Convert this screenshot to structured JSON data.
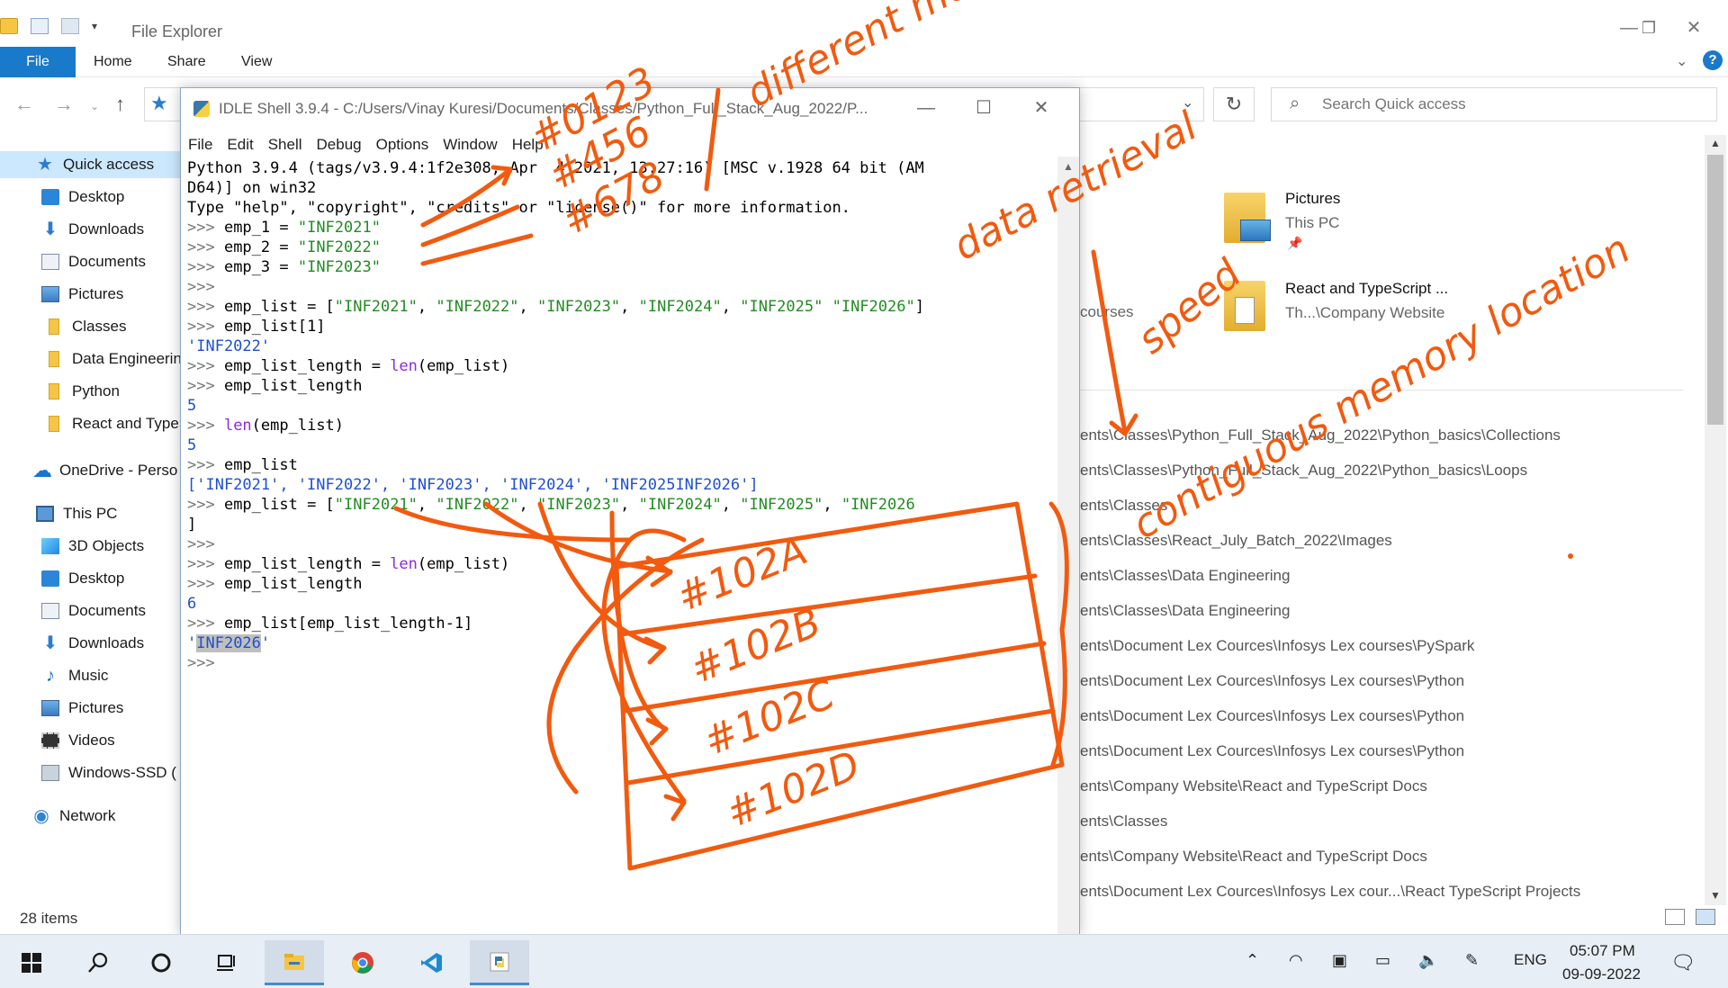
{
  "explorer": {
    "title": "File Explorer",
    "ribbon_tabs": [
      "File",
      "Home",
      "Share",
      "View"
    ],
    "search_placeholder": "Search Quick access",
    "nav_items": [
      {
        "label": "Quick access",
        "icon": "star-icon",
        "selected": true
      },
      {
        "label": "Desktop",
        "icon": "desktop-icon"
      },
      {
        "label": "Downloads",
        "icon": "download-icon"
      },
      {
        "label": "Documents",
        "icon": "documents-icon"
      },
      {
        "label": "Pictures",
        "icon": "pictures-icon"
      },
      {
        "label": "Classes",
        "icon": "folder-icon"
      },
      {
        "label": "Data Engineerin",
        "icon": "folder-icon"
      },
      {
        "label": "Python",
        "icon": "folder-icon"
      },
      {
        "label": "React and TypeS",
        "icon": "folder-icon"
      },
      {
        "label": "OneDrive - Perso",
        "icon": "cloud-icon"
      },
      {
        "label": "This PC",
        "icon": "pc-icon"
      },
      {
        "label": "3D Objects",
        "icon": "3d-objects-icon"
      },
      {
        "label": "Desktop",
        "icon": "desktop-icon"
      },
      {
        "label": "Documents",
        "icon": "documents-icon"
      },
      {
        "label": "Downloads",
        "icon": "download-icon"
      },
      {
        "label": "Music",
        "icon": "music-icon"
      },
      {
        "label": "Pictures",
        "icon": "pictures-icon"
      },
      {
        "label": "Videos",
        "icon": "videos-icon"
      },
      {
        "label": "Windows-SSD (",
        "icon": "drive-icon"
      },
      {
        "label": "Network",
        "icon": "network-icon"
      }
    ],
    "status": "28 items",
    "quick_tiles": [
      {
        "name": "Pictures",
        "sub": "This PC"
      },
      {
        "name": "React and TypeScript ...",
        "sub": "Th...\\Company Website"
      }
    ],
    "partial_text": "courses",
    "recent_paths": [
      "ents\\Classes\\Python_Full_Stack_Aug_2022\\Python_basics\\Collections",
      "ents\\Classes\\Python_Full_Stack_Aug_2022\\Python_basics\\Loops",
      "ents\\Classes",
      "ents\\Classes\\React_July_Batch_2022\\Images",
      "ents\\Classes\\Data Engineering",
      "ents\\Classes\\Data Engineering",
      "ents\\Document Lex Cources\\Infosys Lex courses\\PySpark",
      "ents\\Document Lex Cources\\Infosys Lex courses\\Python",
      "ents\\Document Lex Cources\\Infosys Lex courses\\Python",
      "ents\\Document Lex Cources\\Infosys Lex courses\\Python",
      "ents\\Company Website\\React and TypeScript Docs",
      "ents\\Classes",
      "ents\\Company Website\\React and TypeScript Docs",
      "ents\\Document Lex Cources\\Infosys Lex cour...\\React TypeScript Projects"
    ]
  },
  "idle": {
    "title": "IDLE Shell 3.9.4 - C:/Users/Vinay Kuresi/Documents/Classes/Python_Full_Stack_Aug_2022/P...",
    "menu": [
      "File",
      "Edit",
      "Shell",
      "Debug",
      "Options",
      "Window",
      "Help"
    ],
    "banner": [
      "Python 3.9.4 (tags/v3.9.4:1f2e308, Apr  4 2021, 13:27:16) [MSC v.1928 64 bit (AM",
      "D64)] on win32",
      "Type \"help\", \"copyright\", \"credits\" or \"license()\" for more information."
    ],
    "prompt": ">>> "
  },
  "taskbar": {
    "time": "05:07 PM",
    "date": "09-09-2022",
    "language": "ENG"
  },
  "annotations": {
    "addresses": [
      "#0123",
      "#456",
      "#678"
    ],
    "note_different": "different memory location",
    "note_data": "data retrieval",
    "note_speed": "speed",
    "note_contiguous": "contiguous memory location",
    "cells": [
      "#102A",
      "#102B",
      "#102C",
      "#102D"
    ]
  },
  "colors": {
    "ink": "#f25a0f",
    "file_tab": "#1979ca",
    "string": "#228b22",
    "output": "#1f4fcf"
  }
}
